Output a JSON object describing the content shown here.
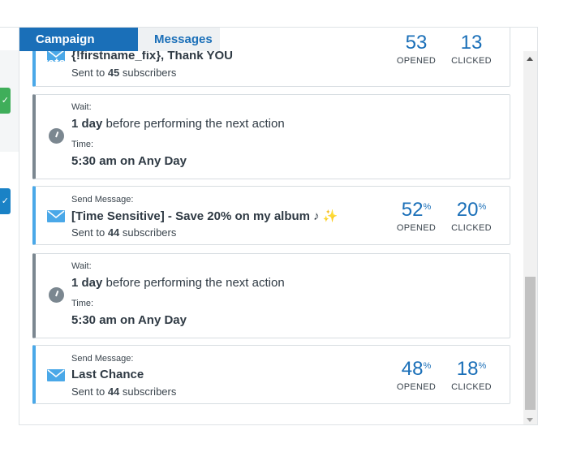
{
  "tabs": [
    {
      "label": "Campaign Stats",
      "active": true
    },
    {
      "label": "Messages",
      "active": false
    }
  ],
  "left_panel": {
    "check_icon": "check-icon"
  },
  "steps": [
    {
      "type": "message",
      "subject": "{!firstname_fix}, Thank YOU",
      "sent_prefix": "Sent to ",
      "sent_count": "45",
      "sent_suffix": " subscribers",
      "opened_value": "53",
      "clicked_value": "13",
      "opened_label": "OPENED",
      "clicked_label": "CLICKED"
    },
    {
      "type": "wait",
      "wait_label": "Wait:",
      "duration": "1 day",
      "duration_suffix": " before performing the next action",
      "time_label": "Time:",
      "time_value": "5:30 am on Any Day"
    },
    {
      "type": "message",
      "send_label": "Send Message:",
      "subject": "[Time Sensitive] - Save 20% on my album ♪ ✨",
      "sent_prefix": "Sent to ",
      "sent_count": "44",
      "sent_suffix": " subscribers",
      "opened_value": "52",
      "clicked_value": "20",
      "percent": "%",
      "opened_label": "OPENED",
      "clicked_label": "CLICKED"
    },
    {
      "type": "wait",
      "wait_label": "Wait:",
      "duration": "1 day",
      "duration_suffix": " before performing the next action",
      "time_label": "Time:",
      "time_value": "5:30 am on Any Day"
    },
    {
      "type": "message",
      "send_label": "Send Message:",
      "subject": "Last Chance",
      "sent_prefix": "Sent to ",
      "sent_count": "44",
      "sent_suffix": " subscribers",
      "opened_value": "48",
      "clicked_value": "18",
      "percent": "%",
      "opened_label": "OPENED",
      "clicked_label": "CLICKED"
    }
  ],
  "colors": {
    "accent": "#1a6fb8",
    "message_border": "#4aa8e8",
    "wait_border": "#7b8790",
    "check_green": "#3fae5a",
    "check_blue": "#1a82c6"
  }
}
